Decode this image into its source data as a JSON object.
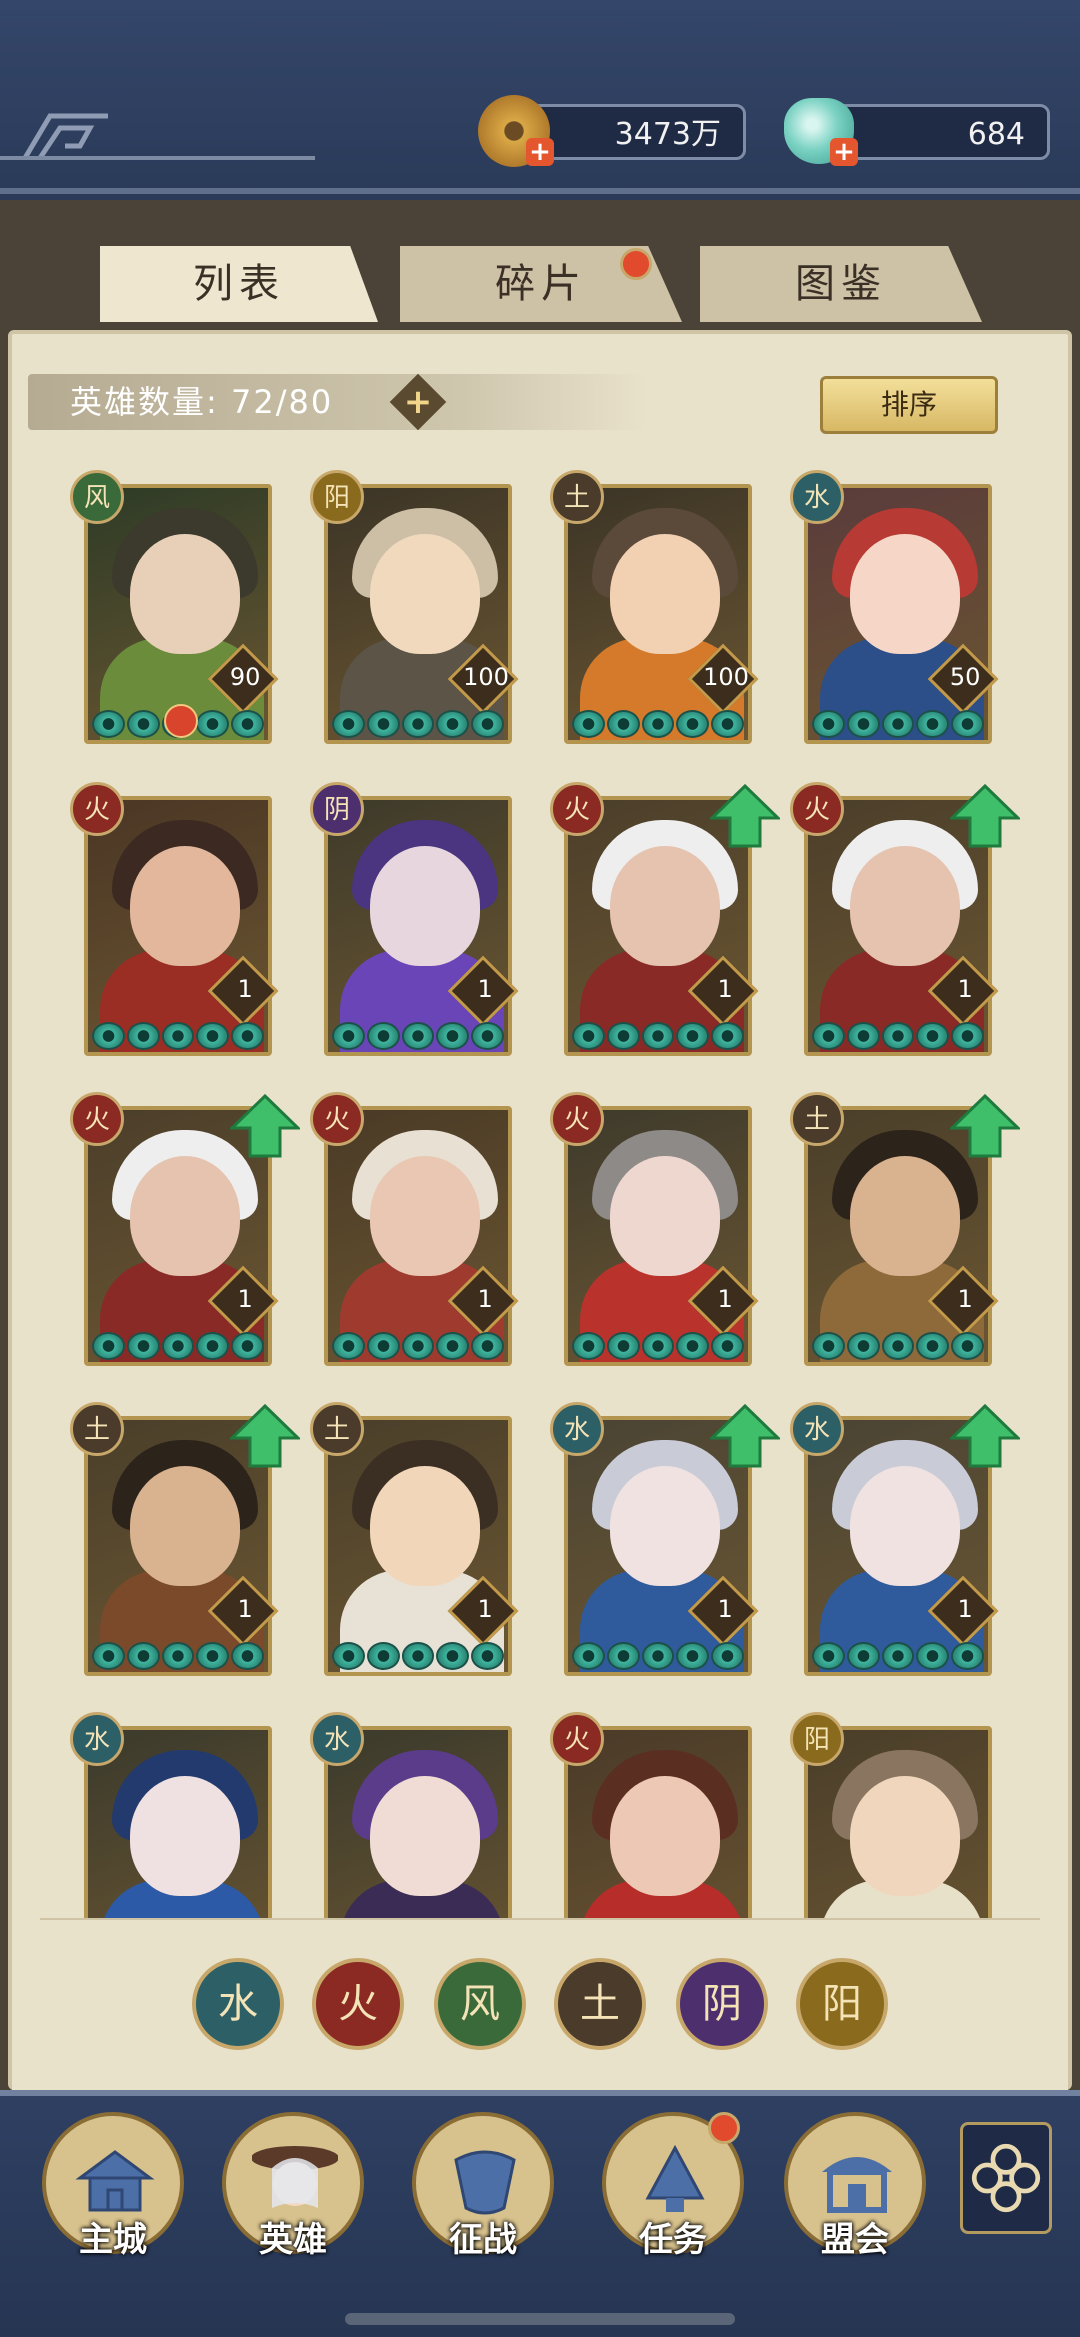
{
  "resources": {
    "coins": "3473万",
    "gems": "684"
  },
  "tabs": [
    "列表",
    "碎片",
    "图鉴"
  ],
  "hero_count": {
    "label": "英雄数量:",
    "value": "72/80"
  },
  "sort_label": "排序",
  "elements": {
    "water": "水",
    "fire": "火",
    "wind": "风",
    "earth": "土",
    "yin": "阴",
    "yang": "阳"
  },
  "heroes": [
    {
      "element": "风",
      "level": "90",
      "stars": 5,
      "upgrade": false,
      "palette": [
        "#2d3b26",
        "#3b3a2c",
        "#6b8c3b",
        "#e8d0b8"
      ],
      "seal": true
    },
    {
      "element": "阳",
      "level": "100",
      "stars": 5,
      "upgrade": false,
      "palette": [
        "#3b3426",
        "#cdbfa5",
        "#5b5447",
        "#f0d9bd"
      ],
      "seal": false
    },
    {
      "element": "土",
      "level": "100",
      "stars": 5,
      "upgrade": false,
      "palette": [
        "#3b3426",
        "#5b4a3a",
        "#d47a2a",
        "#f2d1b3"
      ],
      "seal": false
    },
    {
      "element": "水",
      "level": "50",
      "stars": 5,
      "upgrade": false,
      "palette": [
        "#5a3b3b",
        "#b83a34",
        "#2c4f8a",
        "#f6d6c6"
      ],
      "seal": false
    },
    {
      "element": "火",
      "level": "1",
      "stars": 5,
      "upgrade": false,
      "palette": [
        "#4a3624",
        "#3c2a22",
        "#9a2d24",
        "#e2b79b"
      ],
      "seal": false
    },
    {
      "element": "阴",
      "level": "1",
      "stars": 5,
      "upgrade": false,
      "palette": [
        "#3d3a2a",
        "#4b3580",
        "#6a45b8",
        "#e8d6de"
      ],
      "seal": false
    },
    {
      "element": "火",
      "level": "1",
      "stars": 5,
      "upgrade": true,
      "palette": [
        "#4b3e2a",
        "#eeeeee",
        "#8a2a26",
        "#e6c3ae"
      ],
      "seal": false
    },
    {
      "element": "火",
      "level": "1",
      "stars": 5,
      "upgrade": true,
      "palette": [
        "#4b3e2a",
        "#eeeeee",
        "#8a2a26",
        "#e6c3ae"
      ],
      "seal": false
    },
    {
      "element": "火",
      "level": "1",
      "stars": 5,
      "upgrade": true,
      "palette": [
        "#4b3e2a",
        "#eeeeee",
        "#8a2a26",
        "#e6c3ae"
      ],
      "seal": false
    },
    {
      "element": "火",
      "level": "1",
      "stars": 5,
      "upgrade": false,
      "palette": [
        "#4a3a26",
        "#e8e1d3",
        "#9e3b2e",
        "#e9c7b2"
      ],
      "seal": false
    },
    {
      "element": "火",
      "level": "1",
      "stars": 5,
      "upgrade": false,
      "palette": [
        "#3e3a2c",
        "#8d8a88",
        "#b9322c",
        "#eed7cf"
      ],
      "seal": false
    },
    {
      "element": "土",
      "level": "1",
      "stars": 5,
      "upgrade": true,
      "palette": [
        "#4a3f2a",
        "#2c241b",
        "#8e6a3b",
        "#d9b28f"
      ],
      "seal": false
    },
    {
      "element": "土",
      "level": "1",
      "stars": 5,
      "upgrade": true,
      "palette": [
        "#4a3f2a",
        "#2c241b",
        "#7a4a2b",
        "#d9b28f"
      ],
      "seal": false
    },
    {
      "element": "土",
      "level": "1",
      "stars": 5,
      "upgrade": false,
      "palette": [
        "#4a3f2a",
        "#3a2f22",
        "#e8e2d6",
        "#f1d6ba"
      ],
      "seal": false
    },
    {
      "element": "水",
      "level": "1",
      "stars": 5,
      "upgrade": true,
      "palette": [
        "#4a4434",
        "#c9cbd6",
        "#2f5b9c",
        "#efe2e0"
      ],
      "seal": false
    },
    {
      "element": "水",
      "level": "1",
      "stars": 5,
      "upgrade": true,
      "palette": [
        "#4a4434",
        "#c9cbd6",
        "#2f5b9c",
        "#efe2e0"
      ],
      "seal": false
    },
    {
      "element": "水",
      "level": "",
      "stars": 0,
      "upgrade": false,
      "palette": [
        "#3b3a2c",
        "#223a6e",
        "#2d5aa6",
        "#efe0e2"
      ],
      "seal": false
    },
    {
      "element": "水",
      "level": "",
      "stars": 0,
      "upgrade": false,
      "palette": [
        "#3b3a2c",
        "#5a3c8a",
        "#3a2c54",
        "#f0dcd4"
      ],
      "seal": false
    },
    {
      "element": "火",
      "level": "",
      "stars": 0,
      "upgrade": false,
      "palette": [
        "#4a3a28",
        "#5b2e22",
        "#b72d2a",
        "#edc8b4"
      ],
      "seal": false
    },
    {
      "element": "阳",
      "level": "",
      "stars": 0,
      "upgrade": false,
      "palette": [
        "#4a3e2a",
        "#8a7660",
        "#e8e1c9",
        "#f0d6bc"
      ],
      "seal": false
    }
  ],
  "filter_elements": [
    "水",
    "火",
    "风",
    "土",
    "阴",
    "阳"
  ],
  "nav": [
    "主城",
    "英雄",
    "征战",
    "任务",
    "盟会"
  ],
  "colors": {
    "water": "#2c5f66",
    "fire": "#8a2a22",
    "wind": "#3b6a3a",
    "earth": "#4a3b2a",
    "yin": "#4d2f6e",
    "yang": "#8a6a1c"
  }
}
